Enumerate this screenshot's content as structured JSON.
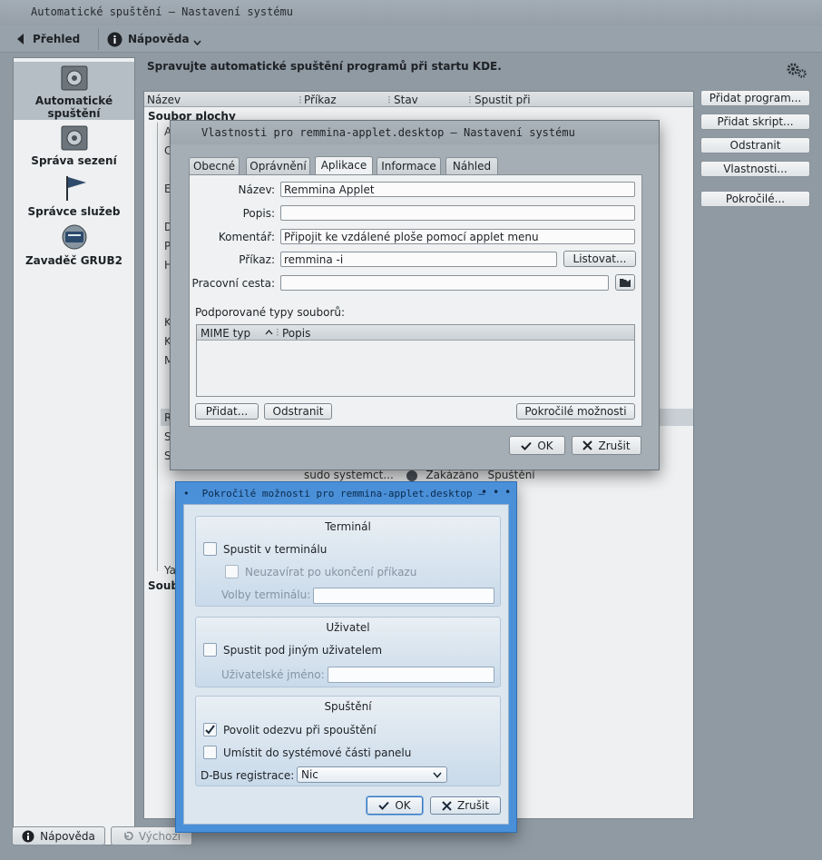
{
  "window": {
    "title": "Automatické spuštění – Nastavení systému"
  },
  "toolbar": {
    "back_label": "Přehled",
    "help_label": "Nápověda"
  },
  "sidebar": {
    "items": [
      {
        "label": "Automatické spuštění"
      },
      {
        "label": "Správa sezení"
      },
      {
        "label": "Správce služeb"
      },
      {
        "label": "Zavaděč GRUB2"
      }
    ]
  },
  "main": {
    "heading": "Spravujte automatické spuštění programů při startu KDE.",
    "columns": [
      "Název",
      "Příkaz",
      "Stav",
      "Spustit při"
    ],
    "groups": [
      "Soubor plochy",
      "Soub"
    ],
    "row_fragments": [
      "A",
      "C",
      "E",
      "D",
      "P",
      "H",
      "K",
      "K",
      "M",
      "R",
      "S",
      "S",
      "Ya"
    ],
    "visible_row": {
      "command": "sudo systemct...",
      "status": "Zakázáno",
      "run_at": "Spuštění"
    },
    "buttons": [
      "Přidat program...",
      "Přidat skript...",
      "Odstranit",
      "Vlastnosti...",
      "Pokročilé..."
    ]
  },
  "footer": {
    "help_label": "Nápověda",
    "defaults_label": "Výchozí"
  },
  "properties_dialog": {
    "title": "Vlastnosti pro remmina-applet.desktop – Nastavení systému",
    "tabs": [
      "Obecné",
      "Oprávnění",
      "Aplikace",
      "Informace",
      "Náhled"
    ],
    "active_tab": "Aplikace",
    "fields": {
      "name_label": "Název:",
      "name_value": "Remmina Applet",
      "desc_label": "Popis:",
      "desc_value": "",
      "comment_label": "Komentář:",
      "comment_value": "Připojit ke vzdálené ploše pomocí applet menu",
      "command_label": "Příkaz:",
      "command_value": "remmina -i",
      "workdir_label": "Pracovní cesta:",
      "workdir_value": ""
    },
    "browse_label": "Listovat...",
    "mime_section": "Podporované typy souborů:",
    "mime_columns": [
      "MIME typ",
      "Popis"
    ],
    "add_label": "Přidat...",
    "remove_label": "Odstranit",
    "advanced_label": "Pokročilé možnosti",
    "ok_label": "OK",
    "cancel_label": "Zrušit"
  },
  "advanced_dialog": {
    "title": "Pokročilé možnosti pro remmina-applet.desktop –",
    "terminal": {
      "title": "Terminál",
      "run_in_terminal": "Spustit v terminálu",
      "no_close": "Neuzavírat po ukončení příkazu",
      "options_label": "Volby terminálu:"
    },
    "user": {
      "title": "Uživatel",
      "run_as_other": "Spustit pod jiným uživatelem",
      "username_label": "Uživatelské jméno:"
    },
    "startup": {
      "title": "Spuštění",
      "feedback": "Povolit odezvu při spouštění",
      "systray": "Umístit do systémové části panelu",
      "dbus_label": "D-Bus registrace:",
      "dbus_value": "Nic"
    },
    "ok_label": "OK",
    "cancel_label": "Zrušit"
  }
}
